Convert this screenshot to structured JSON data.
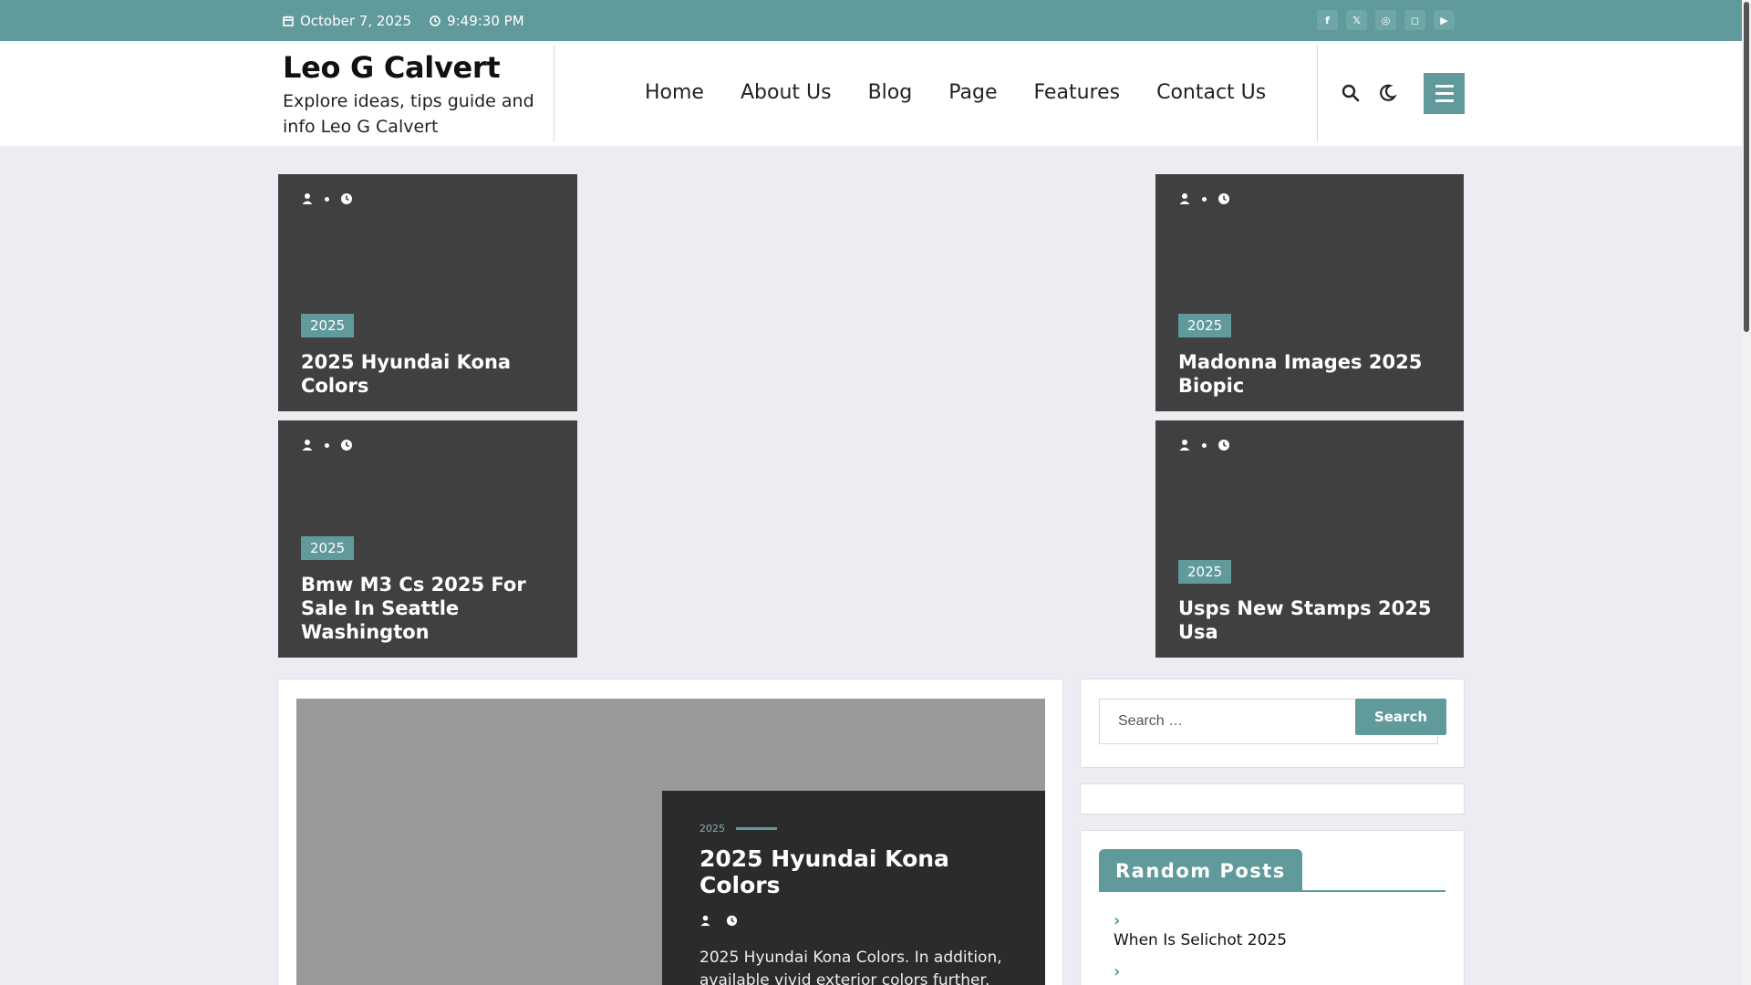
{
  "topbar": {
    "date": "October 7, 2025",
    "time": "9:49:30 PM",
    "socials": [
      "facebook-icon",
      "x-icon",
      "dribbble-icon",
      "instagram-icon",
      "youtube-icon"
    ]
  },
  "header": {
    "site_title": "Leo G Calvert",
    "tagline": "Explore ideas, tips guide and info Leo G Calvert",
    "nav": [
      "Home",
      "About Us",
      "Blog",
      "Page",
      "Features",
      "Contact Us"
    ]
  },
  "featured": [
    {
      "category": "2025",
      "title": "2025 Hyundai Kona Colors"
    },
    {
      "category": "2025",
      "title": "Madonna Images 2025 Biopic"
    },
    {
      "category": "2025",
      "title": "Bmw M3 Cs 2025 For Sale In Seattle Washington"
    },
    {
      "category": "2025",
      "title": "Usps New Stamps 2025 Usa"
    }
  ],
  "main_post": {
    "category": "2025",
    "title": "2025 Hyundai Kona Colors",
    "excerpt": "2025 Hyundai Kona Colors. In addition, available vivid exterior colors further. Available btns and delivers"
  },
  "sidebar": {
    "search_placeholder": "Search …",
    "search_button": "Search",
    "random_posts_title": "Random Posts",
    "random_posts": [
      "When Is Selichot 2025",
      ""
    ]
  },
  "colors": {
    "accent": "#609a9b",
    "card": "#404040",
    "overlay": "#2b2b2b"
  }
}
